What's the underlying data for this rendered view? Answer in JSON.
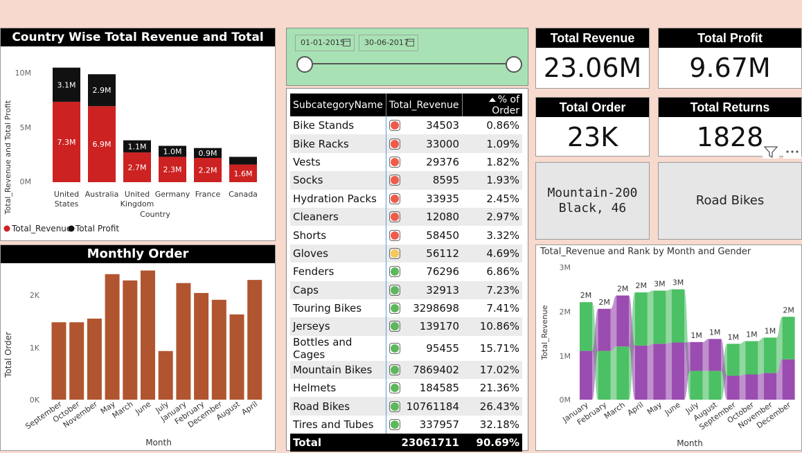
{
  "colors": {
    "background": "#f7d9cd",
    "revenue_red": "#cc2222",
    "profit_black": "#111111",
    "monthly_bar": "#b15530",
    "slicer_green": "#a8e2b4",
    "ribbon_green": "#4cc064",
    "ribbon_purple": "#9a4cb0",
    "status_red": "#f05a4a",
    "status_yellow": "#f5c85a",
    "status_green": "#5cb85c"
  },
  "country_chart": {
    "title": "Country Wise Total Revenue and Total Profit",
    "ylabel": "Total_Revenue and Total Profit",
    "xlabel": "Country",
    "yticks": [
      "10M",
      "5M",
      "0M"
    ],
    "legend": [
      {
        "name": "Total_Revenue",
        "color": "#cc2222"
      },
      {
        "name": "Total Profit",
        "color": "#111111"
      }
    ]
  },
  "monthly_chart": {
    "title": "Monthly Order",
    "ylabel": "Total Order",
    "xlabel": "Month",
    "yticks": [
      "2K",
      "1K",
      "0K"
    ]
  },
  "slicer": {
    "start_date": "01-01-2015",
    "end_date": "30-06-2017"
  },
  "table": {
    "headers": [
      "SubcategoryName",
      "Total_Revenue",
      "% of Order"
    ],
    "rows": [
      {
        "name": "Bike Stands",
        "status": "red",
        "revenue": "34503",
        "pct": "0.86%"
      },
      {
        "name": "Bike Racks",
        "status": "red",
        "revenue": "33000",
        "pct": "1.09%"
      },
      {
        "name": "Vests",
        "status": "red",
        "revenue": "29376",
        "pct": "1.82%"
      },
      {
        "name": "Socks",
        "status": "red",
        "revenue": "8595",
        "pct": "1.93%"
      },
      {
        "name": "Hydration Packs",
        "status": "red",
        "revenue": "33935",
        "pct": "2.45%"
      },
      {
        "name": "Cleaners",
        "status": "red",
        "revenue": "12080",
        "pct": "2.97%"
      },
      {
        "name": "Shorts",
        "status": "red",
        "revenue": "58450",
        "pct": "3.32%"
      },
      {
        "name": "Gloves",
        "status": "yellow",
        "revenue": "56112",
        "pct": "4.69%"
      },
      {
        "name": "Fenders",
        "status": "green",
        "revenue": "76296",
        "pct": "6.86%"
      },
      {
        "name": "Caps",
        "status": "green",
        "revenue": "32913",
        "pct": "7.23%"
      },
      {
        "name": "Touring Bikes",
        "status": "green",
        "revenue": "3298698",
        "pct": "7.41%"
      },
      {
        "name": "Jerseys",
        "status": "green",
        "revenue": "139170",
        "pct": "10.86%"
      },
      {
        "name": "Bottles and Cages",
        "status": "green",
        "revenue": "95455",
        "pct": "15.71%"
      },
      {
        "name": "Mountain Bikes",
        "status": "green",
        "revenue": "7869402",
        "pct": "17.02%"
      },
      {
        "name": "Helmets",
        "status": "green",
        "revenue": "184585",
        "pct": "21.36%"
      },
      {
        "name": "Road Bikes",
        "status": "green",
        "revenue": "10761184",
        "pct": "26.43%"
      },
      {
        "name": "Tires and Tubes",
        "status": "green",
        "revenue": "337957",
        "pct": "32.18%"
      }
    ],
    "total": {
      "label": "Total",
      "revenue": "23061711",
      "pct": "90.69%"
    }
  },
  "kpis": {
    "revenue": {
      "label": "Total Revenue",
      "value": "23.06M"
    },
    "profit": {
      "label": "Total Profit",
      "value": "9.67M"
    },
    "order": {
      "label": "Total Order",
      "value": "23K"
    },
    "returns": {
      "label": "Total Returns",
      "value": "1828"
    }
  },
  "cards": {
    "product_line1": "Mountain-200",
    "product_line2": "Black, 46",
    "subcategory": "Road Bikes"
  },
  "ribbon_chart": {
    "title": "Total_Revenue and Rank by Month and Gender",
    "ylabel": "Total_Revenue",
    "xlabel": "Month",
    "yticks": [
      "3M",
      "2M",
      "1M",
      "0M"
    ]
  },
  "chart_data": [
    {
      "type": "bar",
      "title": "Country Wise Total Revenue and Total Profit",
      "xlabel": "Country",
      "ylabel": "Total_Revenue and Total Profit",
      "ylim": [
        0,
        11
      ],
      "categories": [
        "United States",
        "Australia",
        "United Kingdom",
        "Germany",
        "France",
        "Canada"
      ],
      "series": [
        {
          "name": "Total_Revenue",
          "values": [
            7.3,
            6.9,
            2.7,
            2.3,
            2.2,
            1.6
          ],
          "labels": [
            "7.3M",
            "6.9M",
            "2.7M",
            "2.3M",
            "2.2M",
            "1.6M"
          ]
        },
        {
          "name": "Total Profit",
          "values": [
            3.1,
            2.9,
            1.1,
            1.0,
            0.9,
            0.7
          ],
          "labels": [
            "3.1M",
            "2.9M",
            "1.1M",
            "1.0M",
            "0.9M",
            ""
          ]
        }
      ],
      "stacked": true,
      "legend": "bottom-left"
    },
    {
      "type": "bar",
      "title": "Monthly Order",
      "xlabel": "Month",
      "ylabel": "Total Order",
      "ylim": [
        0,
        2.7
      ],
      "categories": [
        "September",
        "October",
        "November",
        "May",
        "March",
        "June",
        "July",
        "January",
        "February",
        "December",
        "August",
        "April"
      ],
      "values": [
        1.48,
        1.48,
        1.55,
        2.4,
        2.28,
        2.47,
        0.93,
        2.23,
        2.04,
        1.91,
        1.63,
        2.29
      ]
    },
    {
      "type": "area",
      "title": "Total_Revenue and Rank by Month and Gender",
      "xlabel": "Month",
      "ylabel": "Total_Revenue",
      "ylim": [
        0,
        3
      ],
      "categories": [
        "January",
        "February",
        "March",
        "April",
        "May",
        "June",
        "July",
        "August",
        "September",
        "October",
        "November",
        "December"
      ],
      "totals_labels": [
        "2M",
        "2M",
        "2M",
        "2M",
        "3M",
        "3M",
        "1M",
        "1M",
        "1M",
        "1M",
        "1M",
        "2M"
      ],
      "series": [
        {
          "name": "green",
          "values": [
            1.1,
            1.1,
            1.2,
            1.2,
            1.2,
            1.2,
            0.65,
            0.65,
            0.72,
            0.75,
            0.8,
            0.96
          ]
        },
        {
          "name": "purple",
          "values": [
            1.1,
            0.95,
            1.15,
            1.22,
            1.26,
            1.29,
            0.65,
            0.72,
            0.54,
            0.57,
            0.6,
            0.91
          ]
        }
      ]
    }
  ]
}
